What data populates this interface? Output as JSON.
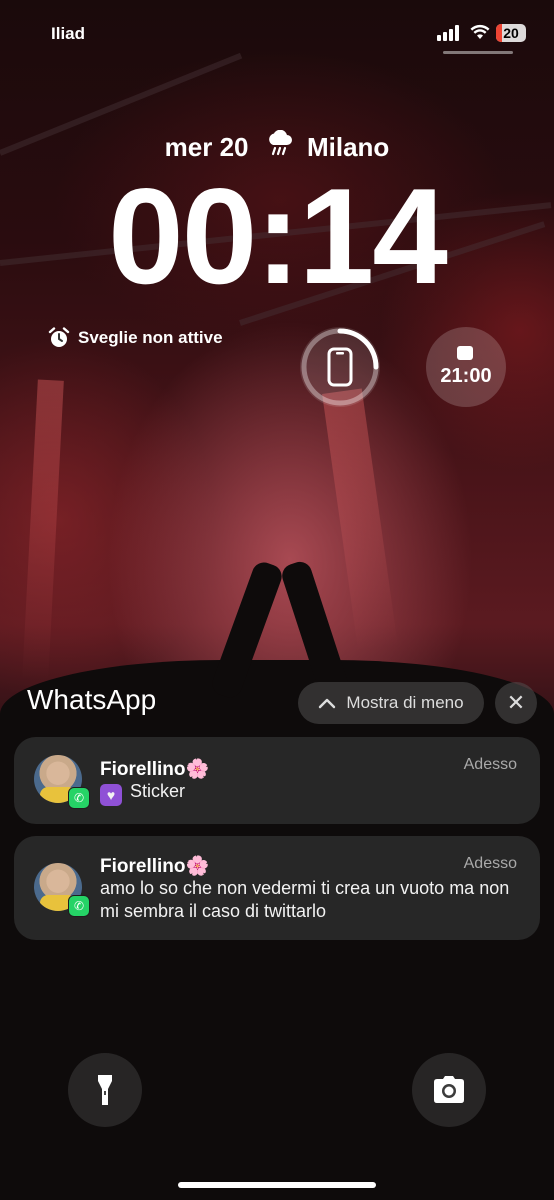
{
  "status_bar": {
    "carrier": "Iliad",
    "battery_level": "20",
    "battery_color": "#e04030"
  },
  "lock_screen": {
    "date": "mer 20",
    "weather_icon": "rain-cloud-icon",
    "location": "Milano",
    "time": "00:14",
    "alarm_label": "Sveglie non attive",
    "phone_widget_icon": "phone-icon",
    "calendar_widget_icon": "calendar-icon",
    "calendar_time": "21:00"
  },
  "notification_group": {
    "app_name": "WhatsApp",
    "show_less_label": "Mostra di meno",
    "close_icon": "close-icon",
    "notifications": [
      {
        "sender": "Fiorellino🌸",
        "time": "Adesso",
        "message": "Sticker",
        "has_sticker_icon": true
      },
      {
        "sender": "Fiorellino🌸",
        "time": "Adesso",
        "message": "amo lo so che non vedermi ti crea un vuoto ma non mi sembra il caso di twittarlo"
      }
    ]
  },
  "bottom_controls": {
    "left_icon": "flashlight-icon",
    "right_icon": "camera-icon"
  },
  "colors": {
    "whatsapp_green": "#25d366",
    "sticker_purple": "#8f51d6",
    "notification_bg": "#2d2d2d"
  }
}
